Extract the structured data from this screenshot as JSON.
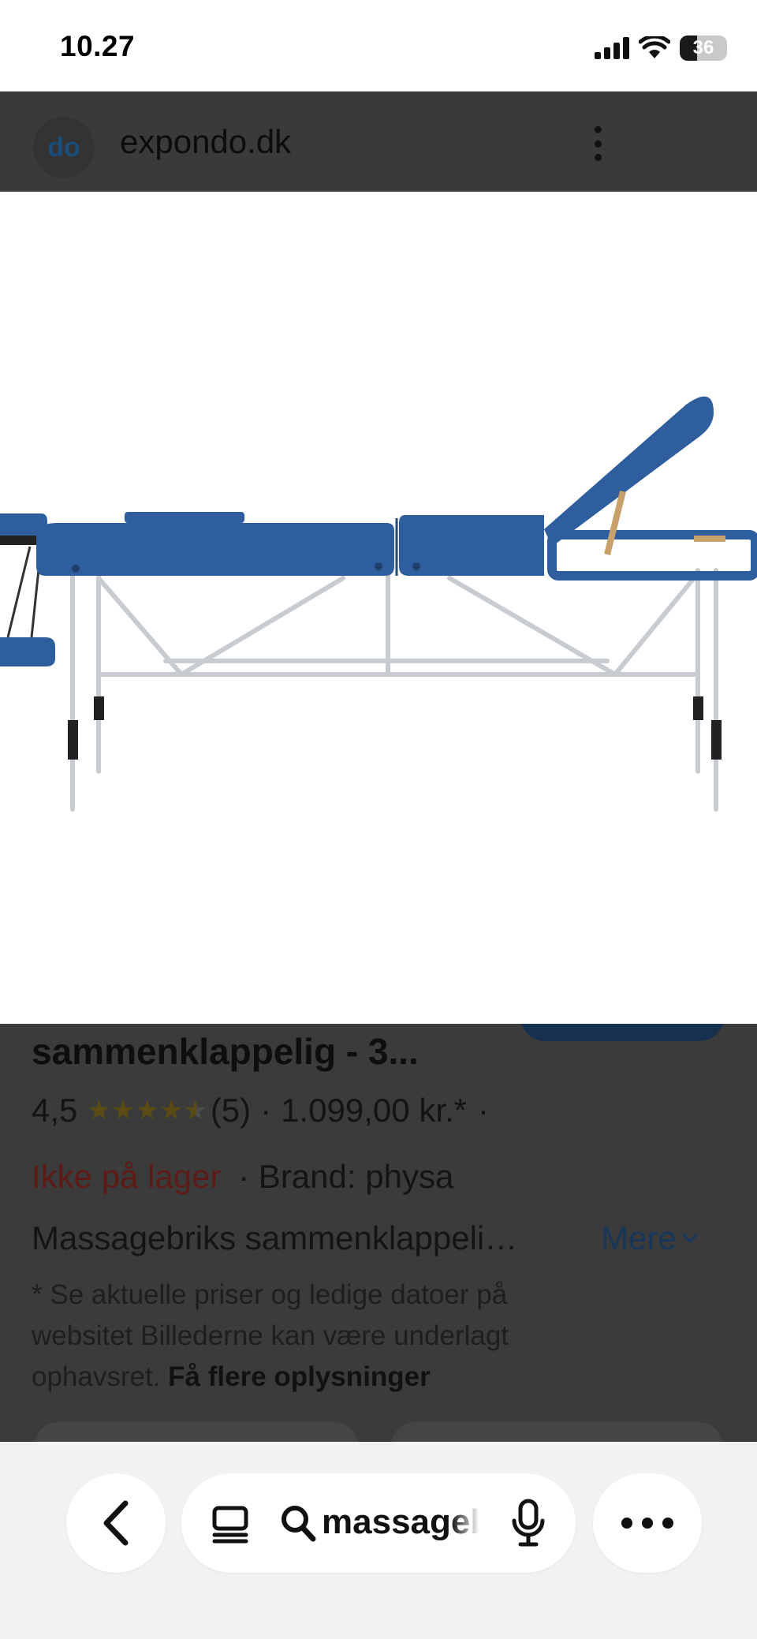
{
  "status_bar": {
    "time": "10.27",
    "battery_level": "36",
    "battery_fraction": 0.36,
    "icons": [
      "signal-icon",
      "wifi-icon",
      "battery-icon"
    ]
  },
  "site": {
    "logo_text": "do",
    "domain": "expondo.dk",
    "menu_icon": "more-vert-icon"
  },
  "product": {
    "title": "sammenklappelig - 3...",
    "rating_value": "4,5",
    "rating_stars": 4.5,
    "review_count": "(5)",
    "separator": "·",
    "price": "1.099,00 kr.*",
    "trailing_separator": "·",
    "stock_status": "Ikke på lager",
    "brand_text": "· Brand: physa",
    "description": "Massagebriks sammenklappeli…",
    "more_label": "Mere",
    "disclaimer": "* Se aktuelle priser og ledige datoer på websitet Billederne kan være underlagt ophavsret.",
    "disclaimer_link": "Få flere oplysninger"
  },
  "toolbar": {
    "back_icon": "back-chevron-icon",
    "tabs_icon": "tabs-icon",
    "search_icon": "search-icon",
    "search_text": "massagebriks",
    "mic_icon": "microphone-icon",
    "more_icon": "more-horiz-icon"
  },
  "colors": {
    "overlay": "#3b3b3b",
    "stock_red": "#5e1a17",
    "link_blue": "#16365a",
    "table_blue": "#2f5e9e",
    "frame_silver": "#c8ccd0"
  }
}
